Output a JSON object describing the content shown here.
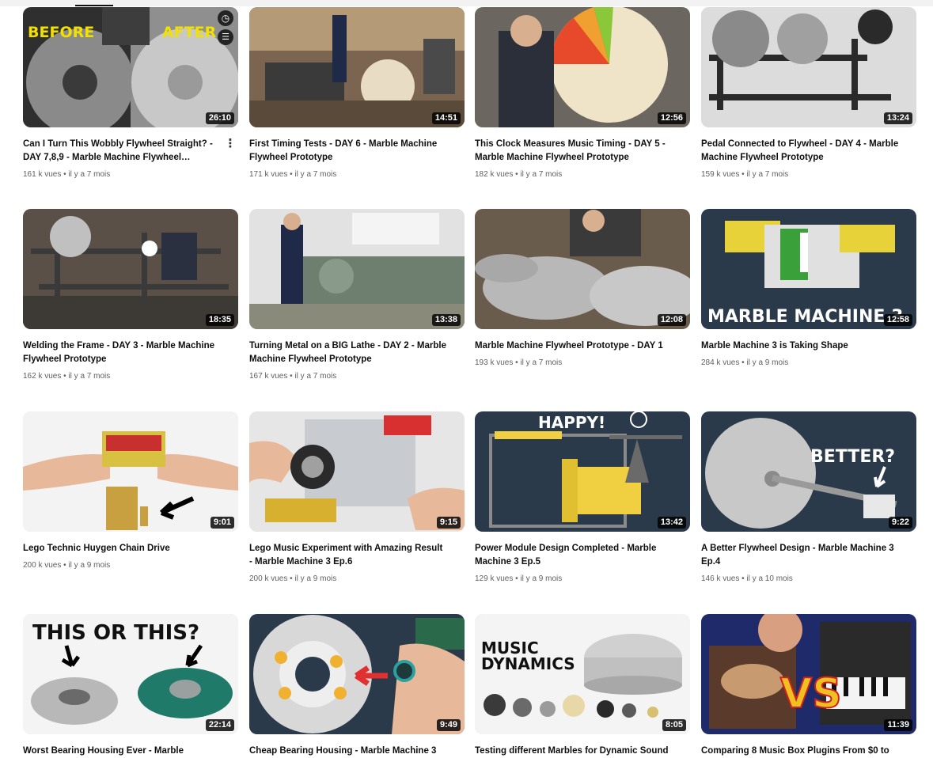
{
  "videos": [
    {
      "title": "Can I Turn This Wobbly Flywheel Straight? - DAY 7,8,9 - Marble Machine Flywheel…",
      "duration": "26:10",
      "views": "161 k vues",
      "age": "il y a 7 mois",
      "thumb_text": [
        "BEFORE",
        "AFTER"
      ],
      "thumb_colors": [
        "#3a3a3a",
        "#bdbdbd"
      ]
    },
    {
      "title": "First Timing Tests - DAY 6 - Marble Machine Flywheel Prototype",
      "duration": "14:51",
      "views": "171 k vues",
      "age": "il y a 7 mois",
      "thumb_colors": [
        "#8a6a4a",
        "#c9b79c"
      ]
    },
    {
      "title": "This Clock Measures Music Timing - DAY 5 - Marble Machine Flywheel Prototype",
      "duration": "12:56",
      "views": "182 k vues",
      "age": "il y a 7 mois",
      "thumb_colors": [
        "#6f6a63",
        "#e8dcc4"
      ]
    },
    {
      "title": "Pedal Connected to Flywheel - DAY 4 - Marble Machine Flywheel Prototype",
      "duration": "13:24",
      "views": "159 k vues",
      "age": "il y a 7 mois",
      "thumb_colors": [
        "#d9d9d9",
        "#3a3a3a"
      ]
    },
    {
      "title": "Welding the Frame - DAY 3 - Marble Machine Flywheel Prototype",
      "duration": "18:35",
      "views": "162 k vues",
      "age": "il y a 7 mois",
      "thumb_colors": [
        "#5a5048",
        "#e0e0e0"
      ]
    },
    {
      "title": "Turning Metal on a BIG Lathe - DAY 2 - Marble Machine Flywheel Prototype",
      "duration": "13:38",
      "views": "167 k vues",
      "age": "il y a 7 mois",
      "thumb_colors": [
        "#d6d6d6",
        "#6a7a6a"
      ]
    },
    {
      "title": "Marble Machine Flywheel Prototype - DAY 1",
      "duration": "12:08",
      "views": "193 k vues",
      "age": "il y a 7 mois",
      "thumb_colors": [
        "#7a6a58",
        "#b8b8b8"
      ]
    },
    {
      "title": "Marble Machine 3 is Taking Shape",
      "duration": "12:58",
      "views": "284 k vues",
      "age": "il y a 9 mois",
      "thumb_text": [
        "MARBLE MACHINE 3"
      ],
      "thumb_colors": [
        "#2a3a4a",
        "#e8d23a"
      ]
    },
    {
      "title": "Lego Technic Huygen Chain Drive",
      "duration": "9:01",
      "views": "200 k vues",
      "age": "il y a 9 mois",
      "thumb_colors": [
        "#f3f3f3",
        "#c8a040"
      ]
    },
    {
      "title": "Lego Music Experiment with Amazing Result - Marble Machine 3 Ep.6",
      "duration": "9:15",
      "views": "200 k vues",
      "age": "il y a 9 mois",
      "thumb_colors": [
        "#e8e8e8",
        "#d8b030"
      ]
    },
    {
      "title": "Power Module Design Completed - Marble Machine 3 Ep.5",
      "duration": "13:42",
      "views": "129 k vues",
      "age": "il y a 9 mois",
      "thumb_text": [
        "HAPPY!"
      ],
      "thumb_colors": [
        "#2a3a4a",
        "#f0d040"
      ]
    },
    {
      "title": "A Better Flywheel Design - Marble Machine 3 Ep.4",
      "duration": "9:22",
      "views": "146 k vues",
      "age": "il y a 10 mois",
      "thumb_text": [
        "BETTER?"
      ],
      "thumb_colors": [
        "#2a3a4a",
        "#c8c8c8"
      ]
    },
    {
      "title": "Worst Bearing Housing Ever - Marble",
      "duration": "22:14",
      "views": "",
      "age": "",
      "thumb_text": [
        "THIS OR THIS?"
      ],
      "thumb_colors": [
        "#f4f4f4",
        "#1f7a6a"
      ]
    },
    {
      "title": "Cheap Bearing Housing - Marble Machine 3",
      "duration": "9:49",
      "views": "",
      "age": "",
      "thumb_colors": [
        "#2a3a4a",
        "#e0e0e0"
      ]
    },
    {
      "title": "Testing different Marbles for Dynamic Sound",
      "duration": "8:05",
      "views": "",
      "age": "",
      "thumb_text": [
        "MUSIC",
        "DYNAMICS"
      ],
      "thumb_colors": [
        "#f4f4f4",
        "#9a9a9a"
      ]
    },
    {
      "title": "Comparing 8 Music Box Plugins From $0 to",
      "duration": "11:39",
      "views": "",
      "age": "",
      "thumb_text": [
        "VS"
      ],
      "thumb_colors": [
        "#1e2a6a",
        "#f0c020"
      ]
    }
  ],
  "meta_separator": "•",
  "icons": {
    "menu": "more-vert-icon",
    "watch_later": "clock-icon",
    "queue": "add-to-queue-icon"
  }
}
